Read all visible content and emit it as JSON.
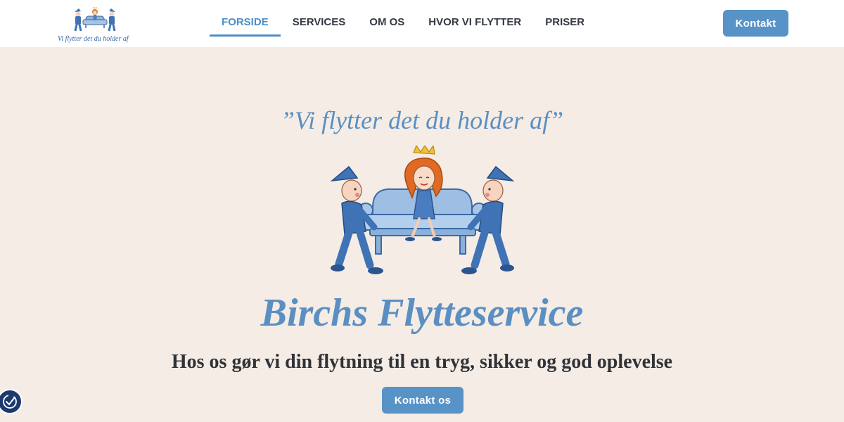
{
  "header": {
    "logo": {
      "tagline": "Vi flytter det du holder af",
      "icon": "movers-carrying-sofa-logo"
    },
    "nav": {
      "items": [
        {
          "label": "FORSIDE",
          "active": true
        },
        {
          "label": "SERVICES",
          "active": false
        },
        {
          "label": "OM OS",
          "active": false
        },
        {
          "label": "HVOR VI FLYTTER",
          "active": false
        },
        {
          "label": "PRISER",
          "active": false
        }
      ]
    },
    "contact_button": "Kontakt"
  },
  "hero": {
    "slogan": "”Vi flytter det du holder af”",
    "illustration_icon": "movers-carrying-princess-on-sofa",
    "title": "Birchs Flytteservice",
    "subtitle": "Hos os gør vi din flytning til en tryg, sikker og god oplevelse",
    "cta_button": "Kontakt os"
  },
  "accessibility_widget": {
    "icon": "accessibility-check-icon"
  },
  "colors": {
    "accent": "#5793c7",
    "background": "#f4ece5",
    "header_bg": "#ffffff",
    "text_dark": "#2f3338"
  }
}
